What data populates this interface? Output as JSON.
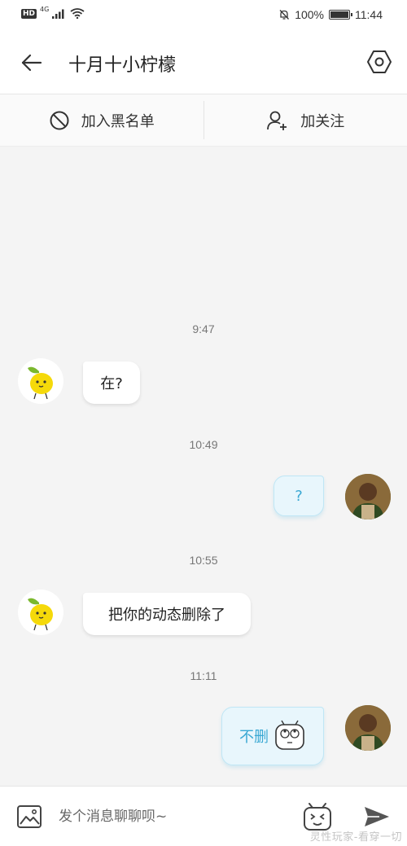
{
  "status_bar": {
    "network": "HD",
    "network_type": "4G",
    "battery": "100%",
    "battery_level": 1.0,
    "time": "11:44"
  },
  "header": {
    "back_icon": "arrow-left-icon",
    "title": "十月十小柠檬",
    "settings_icon": "hexagon-settings-icon"
  },
  "actions": {
    "block_label": "加入黑名单",
    "block_icon": "block-icon",
    "follow_label": "加关注",
    "follow_icon": "add-user-icon"
  },
  "messages": [
    {
      "time": "9:47",
      "side": "left",
      "text": "在?"
    },
    {
      "time": "10:49",
      "side": "right",
      "text": "?"
    },
    {
      "time": "10:55",
      "side": "left",
      "text": "把你的动态删除了"
    },
    {
      "time": "11:11",
      "side": "right",
      "text": "不删",
      "sticker": "rolling-eyes-robot-icon"
    }
  ],
  "input": {
    "placeholder": "发个消息聊聊呗~",
    "image_icon": "image-icon",
    "emoji_icon": "tv-emoji-icon",
    "send_icon": "send-icon"
  },
  "watermark": "灵性玩家-看穿一切",
  "colors": {
    "background": "#f4f4f4",
    "outgoing_bubble": "#e8f6fc",
    "outgoing_text": "#3aa8d3",
    "incoming_bubble": "#ffffff"
  }
}
